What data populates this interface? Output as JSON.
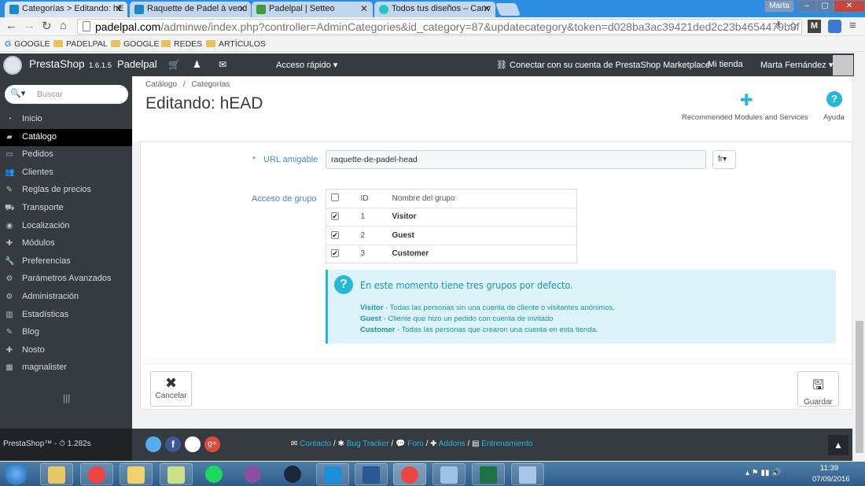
{
  "browser": {
    "tabs": [
      {
        "title": "Categorías > Editando: hE"
      },
      {
        "title": "Raquette de Padel à vend"
      },
      {
        "title": "Padelpal | Setteo"
      },
      {
        "title": "Todos tus diseños – Canv"
      }
    ],
    "user_badge": "Marta",
    "url_host": "padelpal.com",
    "url_path": "/adminwe/index.php?controller=AdminCategories&id_category=87&updatecategory&token=d028ba3ac39421ded2c23b4654479b9f",
    "bookmarks": [
      "GOOGLE",
      "PADELPAL",
      "GOOGLE",
      "REDES",
      "ARTÍCULOS"
    ]
  },
  "header": {
    "logo_text": "PrestaShop",
    "version": "1.6.1.5",
    "shop_name": "Padelpal",
    "quick_access": "Acceso rápido",
    "marketplace": "Conectar con su cuenta de PrestaShop Marketplace",
    "my_shop": "Mi tienda",
    "user": "Marta Fernández"
  },
  "sidebar": {
    "search_placeholder": "Buscar",
    "items": [
      {
        "label": "Inicio",
        "icon": "dashboard-icon"
      },
      {
        "label": "Catálogo",
        "icon": "book-icon"
      },
      {
        "label": "Pedidos",
        "icon": "credit-card-icon"
      },
      {
        "label": "Clientes",
        "icon": "users-icon"
      },
      {
        "label": "Reglas de precios",
        "icon": "tags-icon"
      },
      {
        "label": "Transporte",
        "icon": "truck-icon"
      },
      {
        "label": "Localización",
        "icon": "globe-icon"
      },
      {
        "label": "Módulos",
        "icon": "puzzle-icon"
      },
      {
        "label": "Preferencias",
        "icon": "wrench-icon"
      },
      {
        "label": "Parámetros Avanzados",
        "icon": "cogs-icon"
      },
      {
        "label": "Administración",
        "icon": "cog-icon"
      },
      {
        "label": "Estadísticas",
        "icon": "bar-chart-icon"
      },
      {
        "label": "Blog",
        "icon": "pencil-icon"
      },
      {
        "label": "Nosto",
        "icon": "puzzle-icon"
      },
      {
        "label": "magnalister",
        "icon": "app-icon"
      }
    ],
    "footer_text": "PrestaShop™ - ⏱ 1.282s"
  },
  "page": {
    "breadcrumb_1": "Catálogo",
    "breadcrumb_sep": "/",
    "breadcrumb_2": "Categorías",
    "title": "Editando: hEAD",
    "toolbar_modules": "Recommended Modules and Services",
    "toolbar_help": "Ayuda"
  },
  "form": {
    "url_label": "URL amigable",
    "url_required": "*",
    "url_value": "raquette-de-padel-head",
    "lang": "fr",
    "group_label": "Acceso de grupo",
    "group_headers": {
      "id": "ID",
      "name": "Nombre del grupo"
    },
    "groups": [
      {
        "id": "1",
        "name": "Visitor",
        "checked": "✔"
      },
      {
        "id": "2",
        "name": "Guest",
        "checked": "✔"
      },
      {
        "id": "3",
        "name": "Customer",
        "checked": "✔"
      }
    ],
    "info_title": "En este momento tiene tres grupos por defecto.",
    "info_lines": [
      {
        "term": "Visitor",
        "desc": " - Todas las personas sin una cuenta de cliente o visitantes anónimos."
      },
      {
        "term": "Guest",
        "desc": " - Cliente que hizo un pedido con cuenta de invitado"
      },
      {
        "term": "Customer",
        "desc": " - Todas las personas que crearon una cuenta en esta tienda."
      }
    ],
    "cancel_label": "Cancelar",
    "save_label": "Guardar"
  },
  "footer": {
    "links": [
      "Contacto",
      "Bug Tracker",
      "Foro",
      "Addons",
      "Entrenamiento"
    ],
    "sep": "/"
  },
  "taskbar": {
    "time": "11:39",
    "date": "07/09/2016"
  }
}
